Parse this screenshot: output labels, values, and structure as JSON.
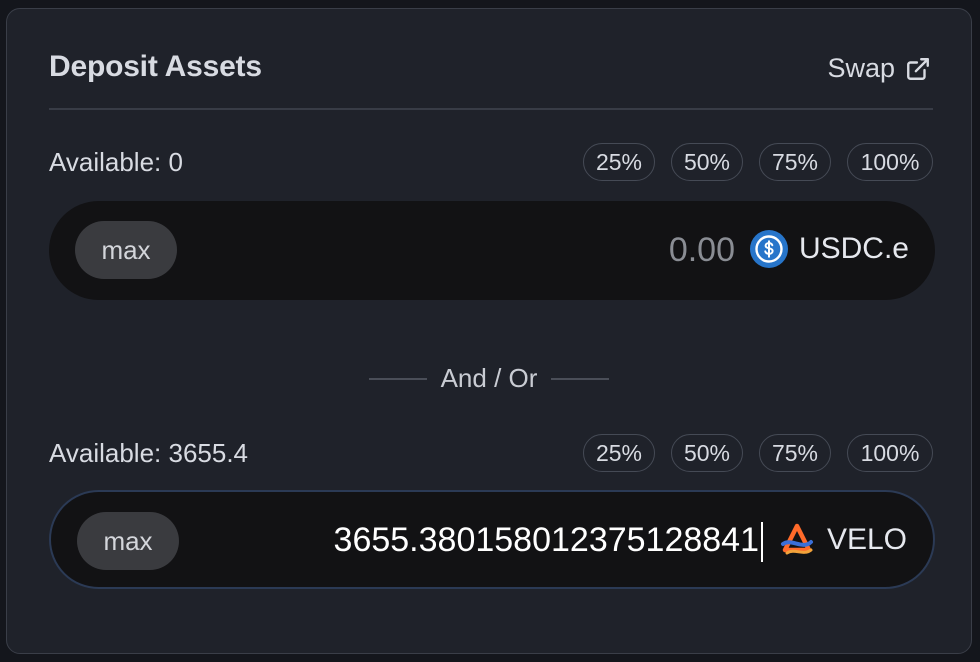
{
  "header": {
    "title": "Deposit Assets",
    "swap_label": "Swap"
  },
  "section1": {
    "available": "Available: 0",
    "percents": [
      "25%",
      "50%",
      "75%",
      "100%"
    ],
    "max_label": "max",
    "amount_placeholder": "0.00",
    "token": "USDC.e"
  },
  "divider_text": "And / Or",
  "section2": {
    "available": "Available: 3655.4",
    "percents": [
      "25%",
      "50%",
      "75%",
      "100%"
    ],
    "max_label": "max",
    "amount_value": "3655.38015801237512884​1",
    "token": "VELO"
  },
  "colors": {
    "usdc_blue": "#2775ca",
    "velo_orange": "#ff6a2a",
    "velo_blue": "#3a6fd8"
  }
}
